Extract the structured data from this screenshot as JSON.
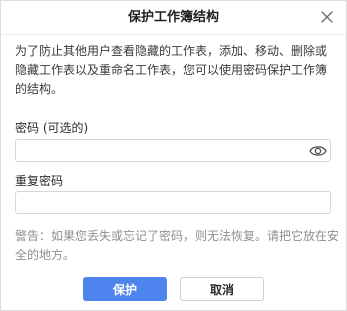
{
  "dialog": {
    "title": "保护工作簿结构",
    "description": "为了防止其他用户查看隐藏的工作表，添加、移动、删除或隐藏工作表以及重命名工作表，您可以使用密码保护工作簿的结构。",
    "password_label": "密码 (可选的)",
    "password_value": "",
    "confirm_label": "重复密码",
    "confirm_value": "",
    "warning": "警告：如果您丢失或忘记了密码，则无法恢复。请把它放在安全的地方。",
    "ok_label": "保护",
    "cancel_label": "取消",
    "close_icon": "close-icon",
    "eye_icon": "eye-icon"
  },
  "colors": {
    "primary": "#4e84ee",
    "warning_text": "#8f8f8f",
    "border": "#d6d6d6"
  }
}
